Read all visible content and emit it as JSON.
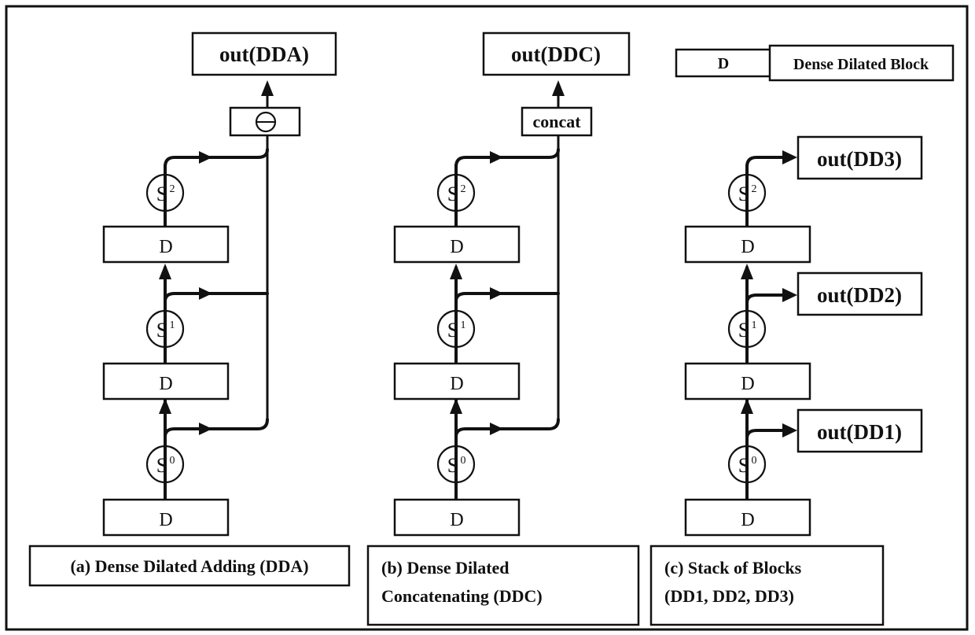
{
  "legend": {
    "block_symbol": "D",
    "block_description": "Dense Dilated Block"
  },
  "panels": [
    {
      "id": "a",
      "output_label": "out(DDA)",
      "merge_label": "⊕",
      "merge_icon": "circled-plus-icon",
      "block_label": "D",
      "scale_labels": [
        {
          "base": "S",
          "sup": "0"
        },
        {
          "base": "S",
          "sup": "1"
        },
        {
          "base": "S",
          "sup": "2"
        }
      ],
      "caption_lines": [
        "(a) Dense Dilated Adding (DDA)"
      ]
    },
    {
      "id": "b",
      "output_label": "out(DDC)",
      "merge_label": "concat",
      "block_label": "D",
      "scale_labels": [
        {
          "base": "S",
          "sup": "0"
        },
        {
          "base": "S",
          "sup": "1"
        },
        {
          "base": "S",
          "sup": "2"
        }
      ],
      "caption_lines": [
        "(b) Dense Dilated",
        "Concatenating (DDC)"
      ]
    },
    {
      "id": "c",
      "block_label": "D",
      "scale_labels": [
        {
          "base": "S",
          "sup": "0"
        },
        {
          "base": "S",
          "sup": "1"
        },
        {
          "base": "S",
          "sup": "2"
        }
      ],
      "outputs": [
        "out(DD1)",
        "out(DD2)",
        "out(DD3)"
      ],
      "caption_lines": [
        "(c) Stack of Blocks",
        "(DD1, DD2, DD3)"
      ]
    }
  ]
}
